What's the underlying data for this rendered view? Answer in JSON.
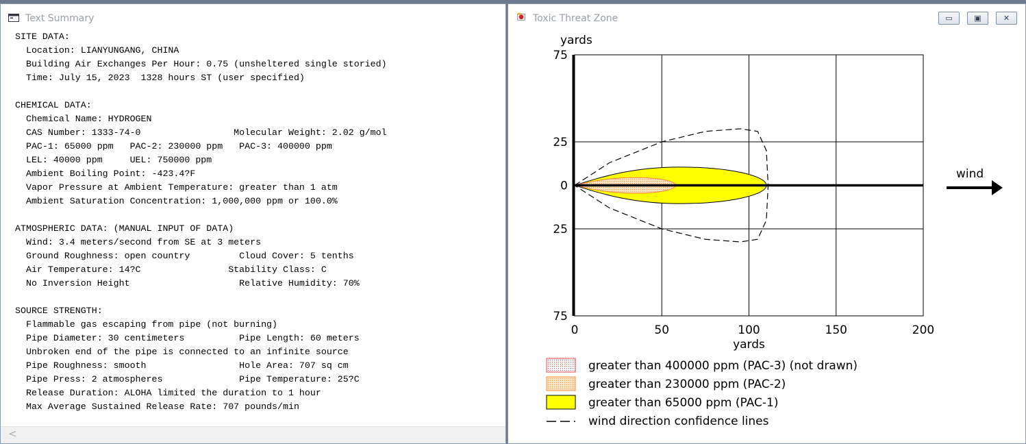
{
  "text_window": {
    "title": "Text Summary",
    "lines": [
      "SITE DATA:",
      "  Location: LIANYUNGANG, CHINA",
      "  Building Air Exchanges Per Hour: 0.75 (unsheltered single storied)",
      "  Time: July 15, 2023  1328 hours ST (user specified)",
      "",
      "CHEMICAL DATA:",
      "  Chemical Name: HYDROGEN",
      "  CAS Number: 1333-74-0                 Molecular Weight: 2.02 g/mol",
      "  PAC-1: 65000 ppm   PAC-2: 230000 ppm   PAC-3: 400000 ppm",
      "  LEL: 40000 ppm     UEL: 750000 ppm",
      "  Ambient Boiling Point: -423.4?F",
      "  Vapor Pressure at Ambient Temperature: greater than 1 atm",
      "  Ambient Saturation Concentration: 1,000,000 ppm or 100.0%",
      "",
      "ATMOSPHERIC DATA: (MANUAL INPUT OF DATA)",
      "  Wind: 3.4 meters/second from SE at 3 meters",
      "  Ground Roughness: open country         Cloud Cover: 5 tenths",
      "  Air Temperature: 14?C                Stability Class: C",
      "  No Inversion Height                    Relative Humidity: 70%",
      "",
      "SOURCE STRENGTH:",
      "  Flammable gas escaping from pipe (not burning)",
      "  Pipe Diameter: 30 centimeters          Pipe Length: 60 meters",
      "  Unbroken end of the pipe is connected to an infinite source",
      "  Pipe Roughness: smooth                 Hole Area: 707 sq cm",
      "  Pipe Press: 2 atmospheres              Pipe Temperature: 25?C",
      "  Release Duration: ALOHA limited the duration to 1 hour",
      "  Max Average Sustained Release Rate: 707 pounds/min"
    ],
    "scroll_left_glyph": "<"
  },
  "plot_window": {
    "title": "Toxic Threat Zone",
    "buttons": {
      "minimize": "▭",
      "maximize": "▣",
      "close": "✕"
    },
    "wind_label": "wind",
    "colors": {
      "pac1": "#ffff00",
      "pac2": "#ffc88c",
      "pac3": "#ff5050",
      "confidence": "#000000"
    },
    "legend": [
      {
        "key": "pac3",
        "label": "greater than 400000 ppm (PAC-3) (not drawn)"
      },
      {
        "key": "pac2",
        "label": "greater than 230000 ppm (PAC-2)"
      },
      {
        "key": "pac1",
        "label": "greater than 65000 ppm (PAC-1)"
      },
      {
        "key": "confidence",
        "label": "wind direction confidence lines"
      }
    ]
  },
  "chart_data": {
    "type": "area",
    "xlabel": "yards",
    "ylabel": "yards",
    "xlim": [
      0,
      200
    ],
    "ylim": [
      -75,
      75
    ],
    "x_ticks": [
      "0",
      "50",
      "100",
      "150",
      "200"
    ],
    "y_ticks": [
      "75",
      "25",
      "0",
      "25",
      "75"
    ],
    "y_tick_values": [
      75,
      25,
      0,
      -25,
      -75
    ],
    "grid": true,
    "series": [
      {
        "name": "greater than 65000 ppm (PAC-1)",
        "key": "pac1",
        "max_downwind": 110,
        "max_halfwidth": 10.5,
        "peak_x": 60
      },
      {
        "name": "greater than 230000 ppm (PAC-2)",
        "key": "pac2",
        "max_downwind": 58,
        "max_halfwidth": 4.5,
        "peak_x": 35
      },
      {
        "name": "wind direction confidence lines",
        "key": "confidence",
        "points": [
          [
            0,
            0
          ],
          [
            20,
            13
          ],
          [
            50,
            25
          ],
          [
            75,
            31
          ],
          [
            95,
            32.5
          ],
          [
            105,
            31
          ],
          [
            110,
            20
          ],
          [
            111,
            0
          ],
          [
            110,
            -20
          ],
          [
            105,
            -31
          ],
          [
            95,
            -32.5
          ],
          [
            75,
            -31
          ],
          [
            50,
            -25
          ],
          [
            20,
            -13
          ],
          [
            0,
            0
          ]
        ]
      }
    ]
  }
}
